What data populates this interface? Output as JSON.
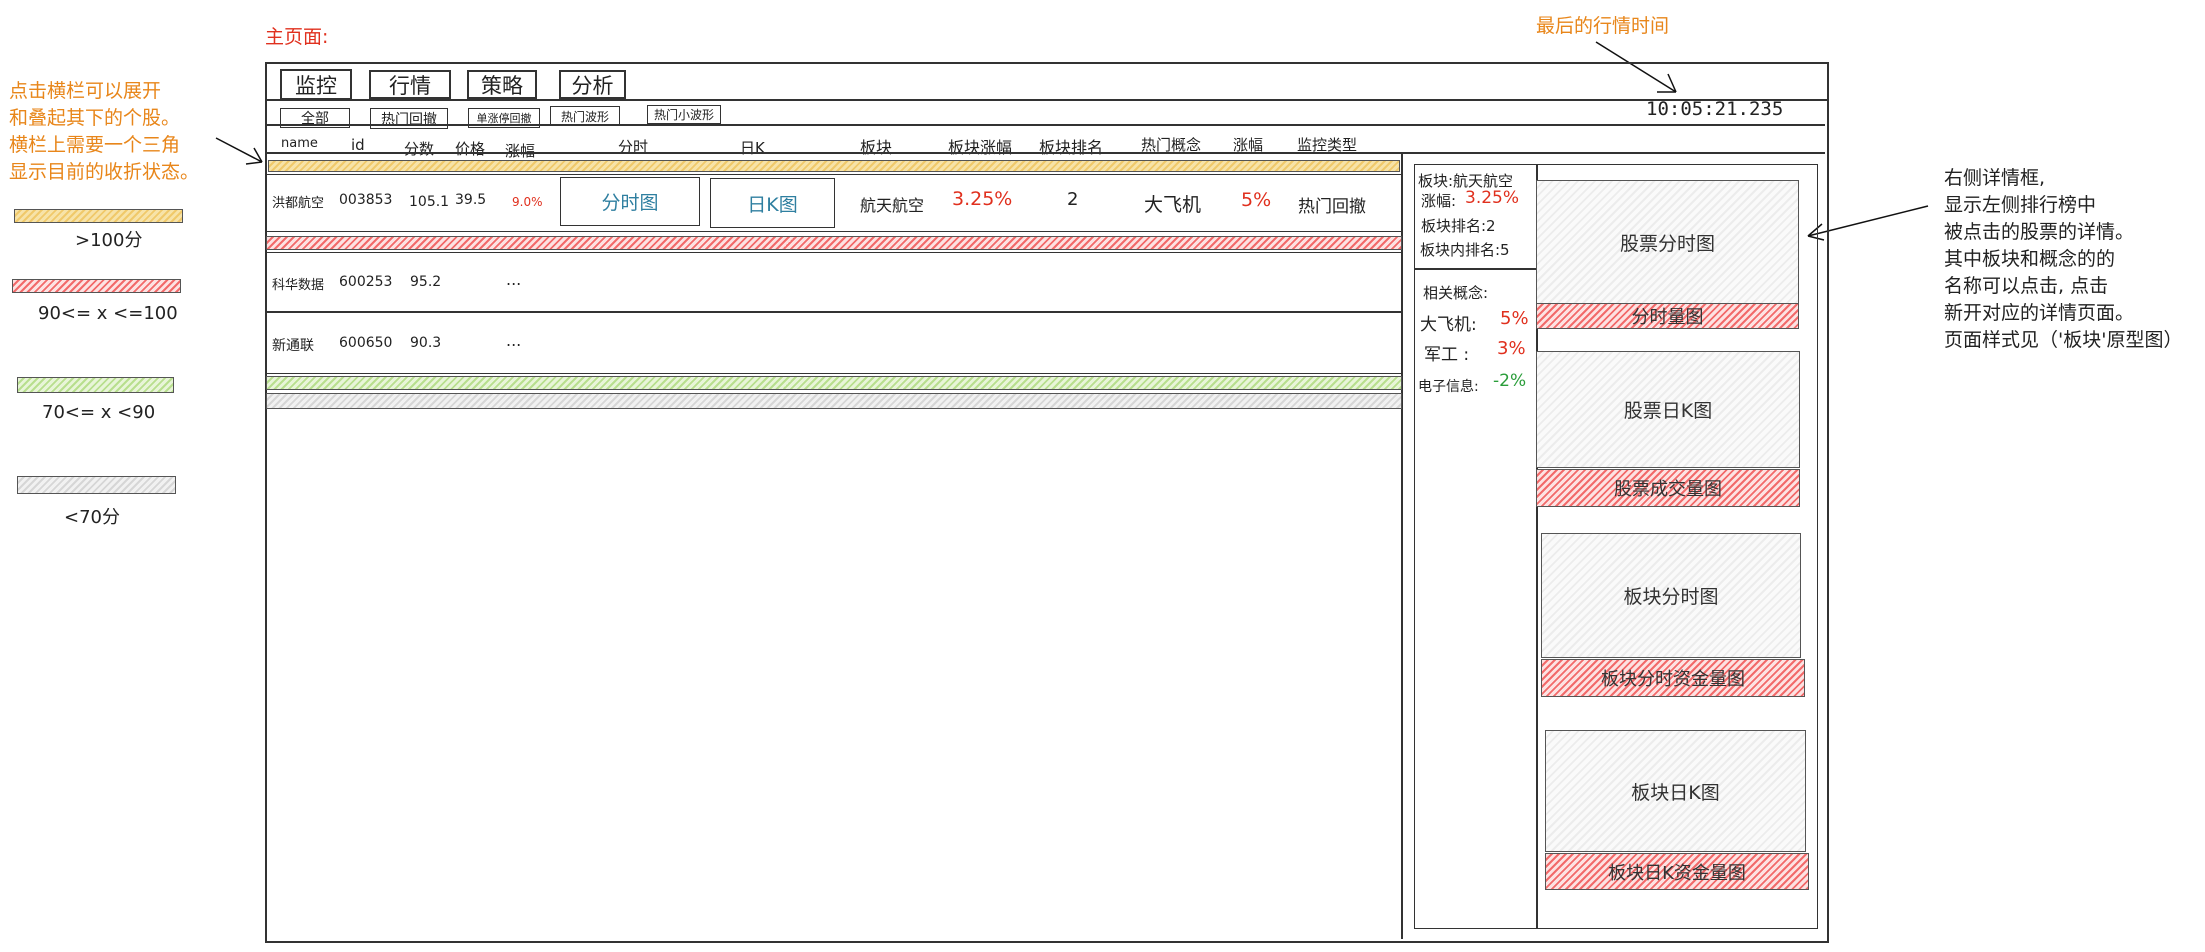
{
  "page_title": "主页面:",
  "time_note": "最后的行情时间",
  "collapse_note": [
    "点击横栏可以展开",
    "和叠起其下的个股。",
    "横栏上需要一个三角",
    "显示目前的收折状态。"
  ],
  "legend": [
    {
      "label": ">100分",
      "color": "#f0c96a"
    },
    {
      "label": "90<= x <=100",
      "color": "#f26a6a"
    },
    {
      "label": "70<= x <90",
      "color": "#b8df8e"
    },
    {
      "label": "<70分",
      "color": "#d6d6d6"
    }
  ],
  "detail_note": [
    "右侧详情框,",
    "显示左侧排行榜中",
    "被点击的股票的详情。",
    "其中板块和概念的的",
    "名称可以点击, 点击",
    "新开对应的详情页面。",
    "页面样式见（'板块'原型图）"
  ],
  "tabs": [
    "监控",
    "行情",
    "策略",
    "分析"
  ],
  "filters": [
    "全部",
    "热门回撤",
    "单涨停回撤",
    "热门波形",
    "热门小波形"
  ],
  "market_time": "10:05:21.235",
  "columns": [
    "name",
    "id",
    "分数",
    "价格",
    "涨幅",
    "分时",
    "日K",
    "板块",
    "板块涨幅",
    "板块排名",
    "热门概念",
    "涨幅",
    "监控类型"
  ],
  "rows": [
    {
      "name": "洪都航空",
      "id": "003853",
      "score": "105.1",
      "price": "39.5",
      "change": "9.0%",
      "intraday_btn": "分时图",
      "daily_btn": "日K图",
      "sector": "航天航空",
      "sector_change": "3.25%",
      "sector_rank": "2",
      "concept": "大飞机",
      "concept_change": "5%",
      "monitor_type": "热门回撤"
    },
    {
      "name": "科华数据",
      "id": "600253",
      "score": "95.2",
      "ellipsis": "..."
    },
    {
      "name": "新通联",
      "id": "600650",
      "score": "90.3",
      "ellipsis": "..."
    }
  ],
  "detail": {
    "sector_line": "板块:航天航空",
    "change_label": "涨幅:",
    "change_value": "3.25%",
    "sector_rank": "板块排名:2",
    "in_sector_rank": "板块内排名:5",
    "related_concepts_label": "相关概念:",
    "concepts": [
      {
        "name": "大飞机:",
        "value": "5%"
      },
      {
        "name": "军工 :",
        "value": "3%"
      },
      {
        "name": "电子信息:",
        "value": "-2%"
      }
    ],
    "charts": [
      "股票分时图",
      "分时量图",
      "股票日K图",
      "股票成交量图",
      "板块分时图",
      "板块分时资金量图",
      "板块日K图",
      "板块日K资金量图"
    ]
  },
  "colors": {
    "annotation": "#e8861a",
    "title": "#e0301e",
    "up": "#e0301e",
    "down": "#2a9d3a",
    "link": "#2f7fa0"
  }
}
